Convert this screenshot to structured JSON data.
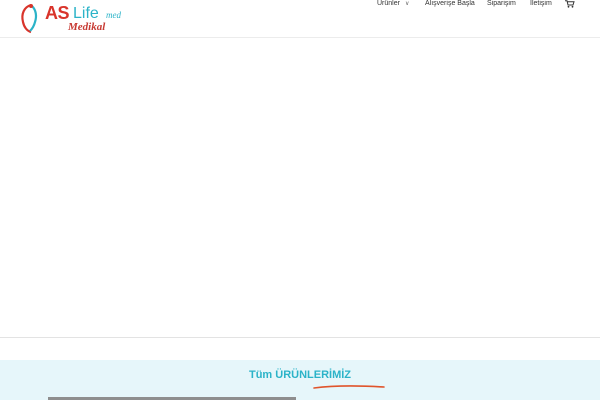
{
  "brand": {
    "as": "AS",
    "life": "Life",
    "med": "med",
    "medikal": "Medikal",
    "colors": {
      "red": "#d9342b",
      "teal": "#2bb3c8"
    }
  },
  "nav": {
    "items": [
      {
        "label": "Ürünler",
        "has_dropdown": true
      },
      {
        "label": "Alışverişe Başla"
      },
      {
        "label": "Siparişim"
      },
      {
        "label": "İletişim"
      }
    ],
    "cart_icon": "shopping-cart-icon"
  },
  "products_section": {
    "title": "Tüm ÜRÜNLERİMİZ",
    "accent_color": "#e0542b",
    "background": "#e6f6fa"
  }
}
